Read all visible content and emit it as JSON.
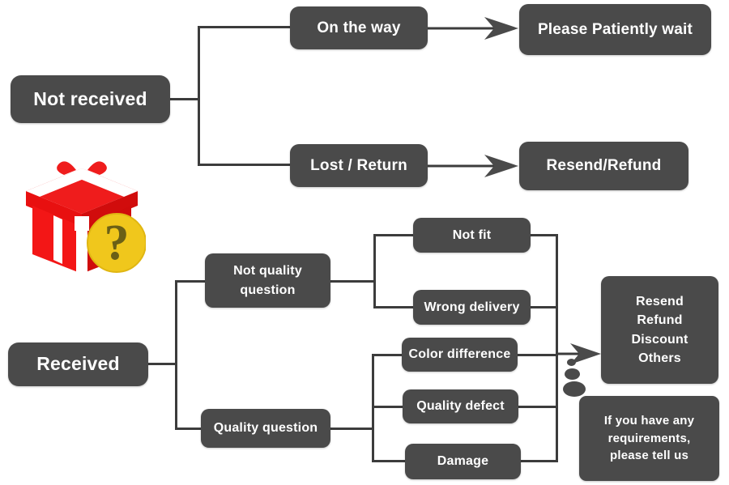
{
  "diagram": {
    "title": "Order status handling flowchart",
    "colors": {
      "box_fill": "#4a4a4a",
      "box_text": "#ffffff",
      "connector": "#3c3c3c",
      "background": "#ffffff",
      "gift_red": "#ef1c1c",
      "gift_ribbon": "#ffffff",
      "badge_yellow": "#f5c51f",
      "badge_mark": "#6b6016"
    },
    "icons": {
      "gift_box": "gift-box-icon",
      "question_badge": "question-mark-badge-icon"
    }
  },
  "nodes": {
    "not_received": "Not received",
    "on_the_way": "On the way",
    "please_wait": "Please Patiently wait",
    "lost_return": "Lost / Return",
    "resend_refund": "Resend/Refund",
    "received": "Received",
    "not_quality_question_l1": "Not quality",
    "not_quality_question_l2": "question",
    "quality_question": "Quality question",
    "not_fit": "Not fit",
    "wrong_delivery": "Wrong delivery",
    "color_difference": "Color difference",
    "quality_defect": "Quality defect",
    "damage": "Damage",
    "options_1": "Resend",
    "options_2": "Refund",
    "options_3": "Discount",
    "options_4": "Others",
    "note_l1": "If you have any",
    "note_l2": "requirements,",
    "note_l3": "please tell us"
  }
}
